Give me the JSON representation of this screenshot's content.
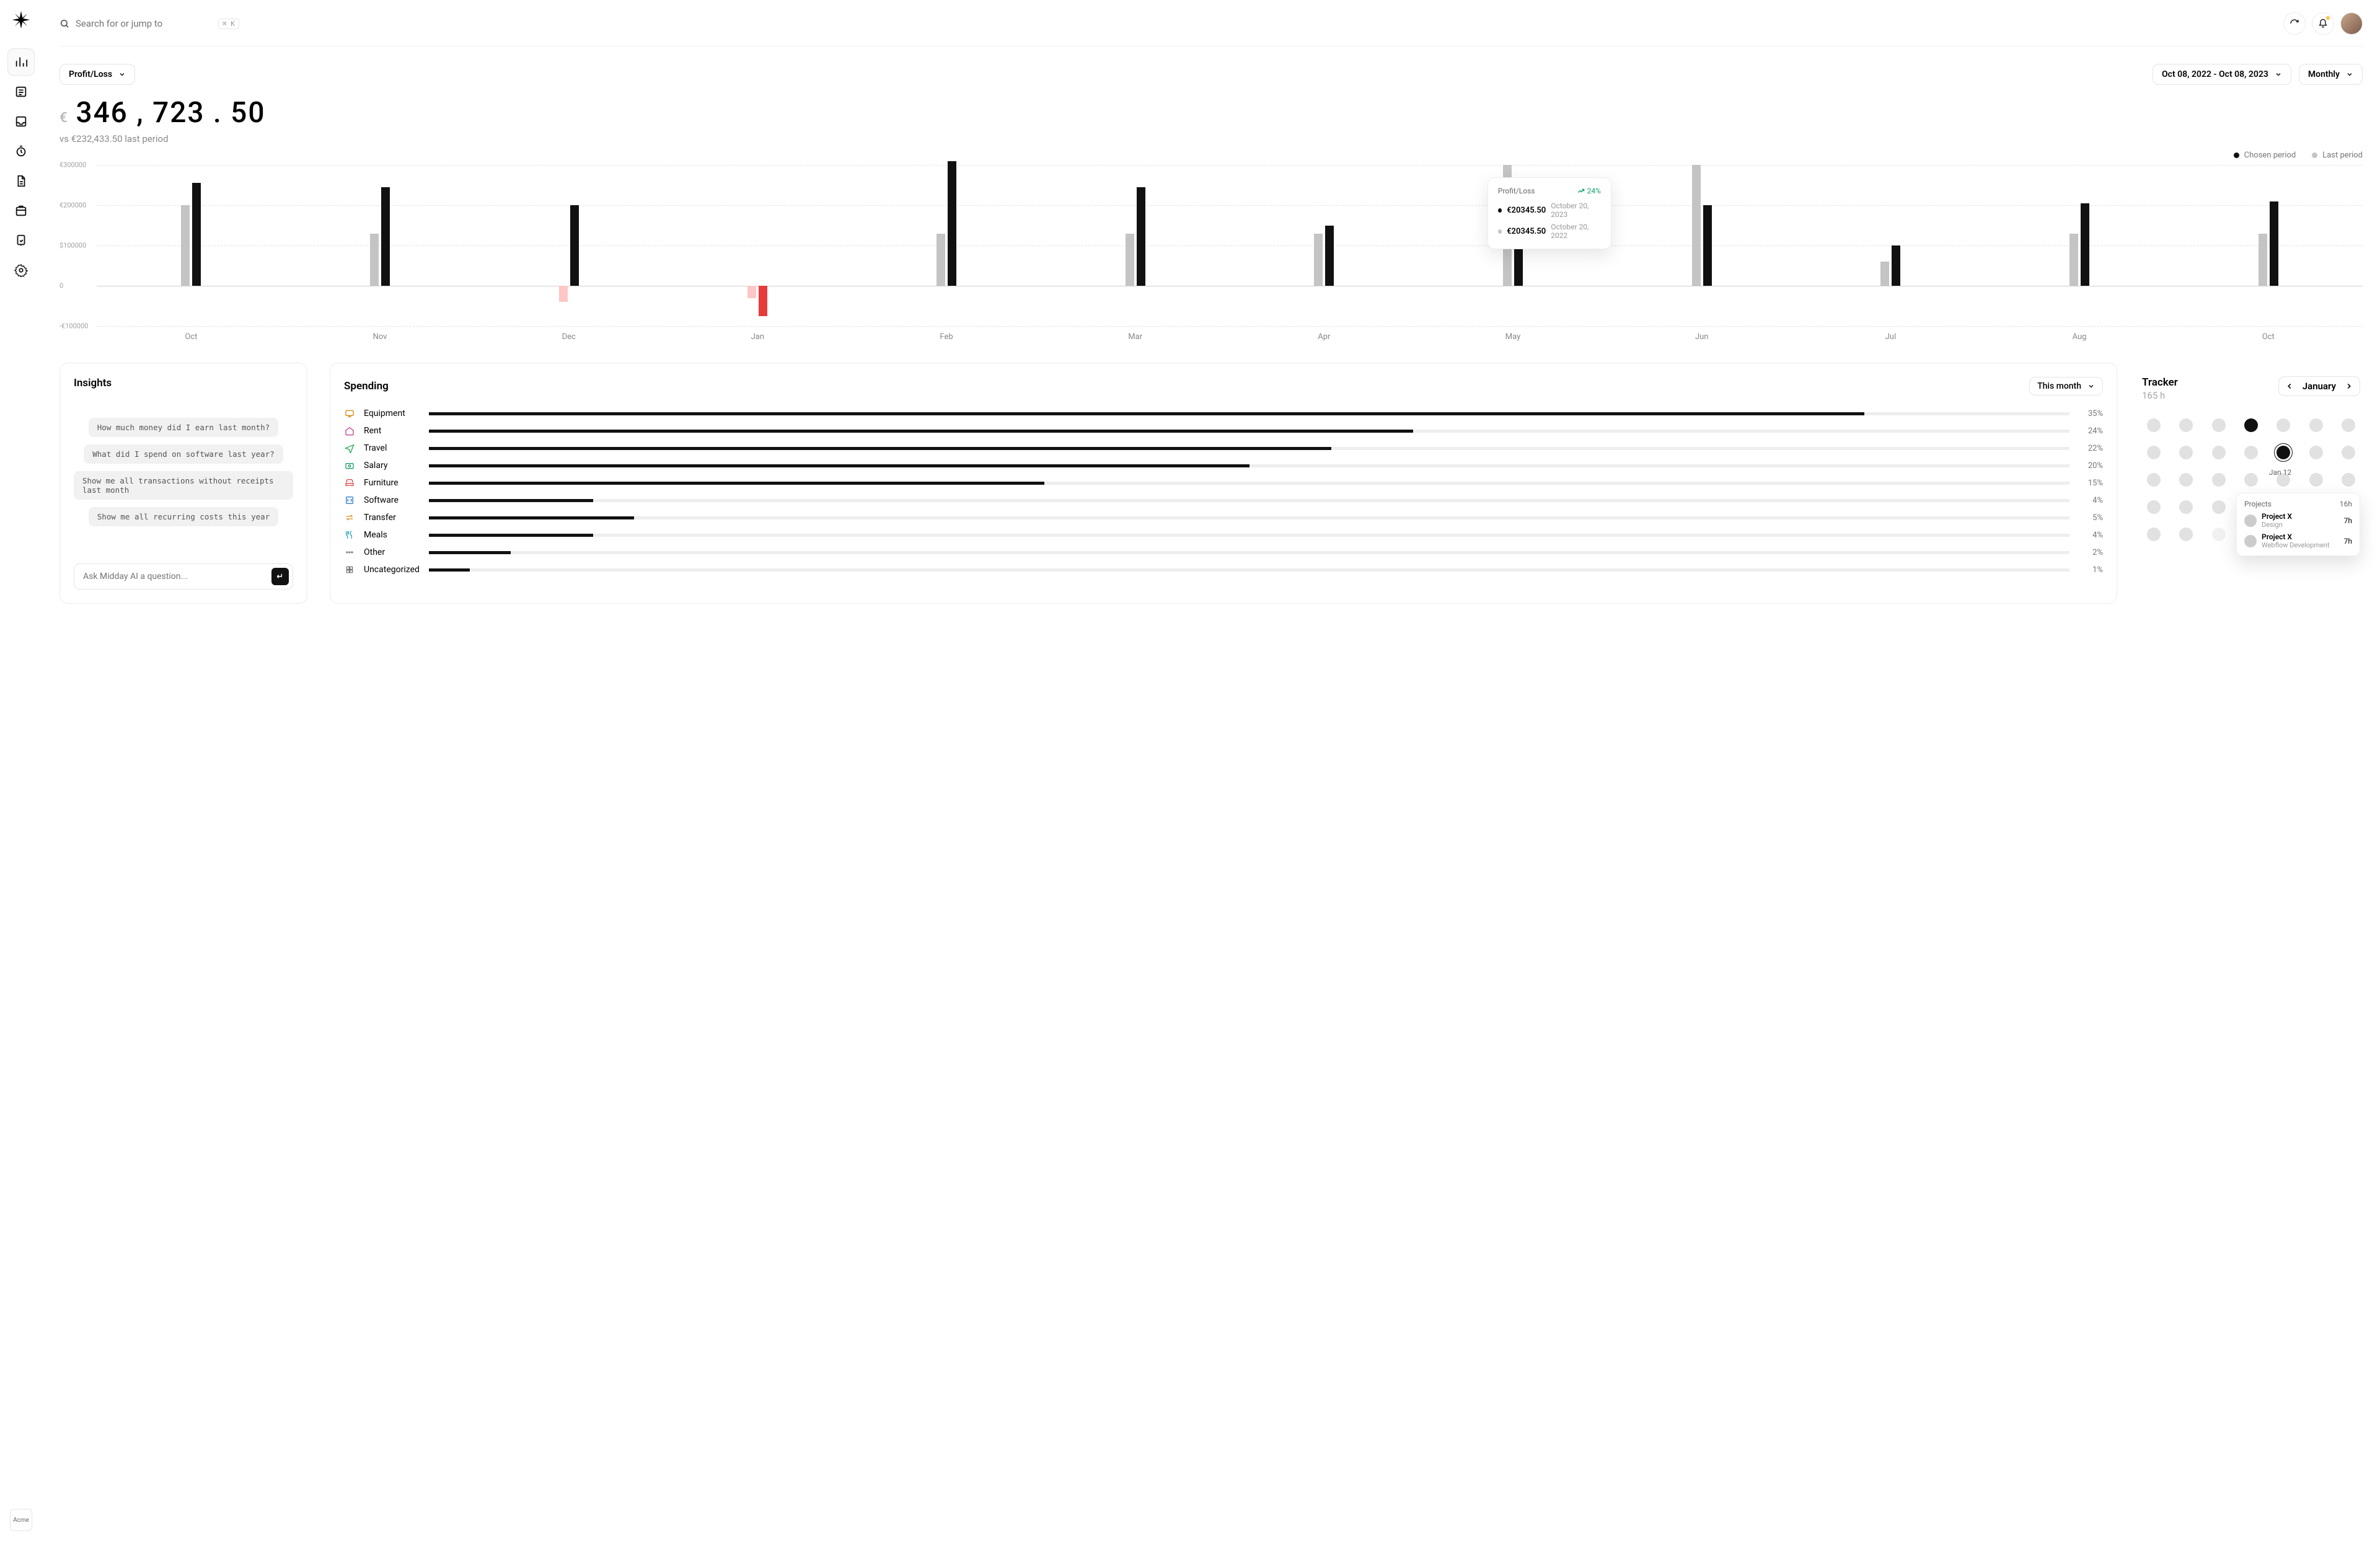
{
  "search": {
    "placeholder": "Search for or jump to",
    "shortcut": "⌘ K"
  },
  "header_actions": {
    "refresh": "refresh",
    "notifications": "notifications"
  },
  "team": {
    "label": "Acme"
  },
  "sidebar": {
    "items": [
      {
        "name": "overview",
        "active": true
      },
      {
        "name": "transactions",
        "active": false
      },
      {
        "name": "inbox",
        "active": false
      },
      {
        "name": "tracker",
        "active": false
      },
      {
        "name": "invoices",
        "active": false
      },
      {
        "name": "vault",
        "active": false
      },
      {
        "name": "apps",
        "active": false
      },
      {
        "name": "settings",
        "active": false
      }
    ]
  },
  "metric_selector": {
    "label": "Profit/Loss"
  },
  "date_range": {
    "label": "Oct 08, 2022 - Oct 08, 2023"
  },
  "granularity": {
    "label": "Monthly"
  },
  "amount": {
    "currency": "€",
    "value": "346 , 723 . 50",
    "compare_prefix": "vs ",
    "compare_value": "€232,433.50 last period"
  },
  "legend": {
    "chosen": "Chosen period",
    "last": "Last period"
  },
  "tooltip": {
    "title": "Profit/Loss",
    "change": "24%",
    "rows": [
      {
        "value": "€20345.50",
        "date": "October 20, 2023",
        "color": "#111"
      },
      {
        "value": "€20345.50",
        "date": "October 20, 2022",
        "color": "#c4c4c4"
      }
    ]
  },
  "chart_data": {
    "type": "bar",
    "title": "Profit/Loss",
    "ylabel": "",
    "xlabel": "",
    "ylim": [
      -100000,
      300000
    ],
    "currency_tick_prefix_pos": "€",
    "currency_tick_prefix_first": "$",
    "categories": [
      "Oct",
      "Nov",
      "Dec",
      "Jan",
      "Feb",
      "Mar",
      "Apr",
      "May",
      "Jun",
      "Jul",
      "Aug",
      "Oct"
    ],
    "series": [
      {
        "name": "Last period",
        "values": [
          200000,
          130000,
          -40000,
          -30000,
          130000,
          130000,
          130000,
          300000,
          300000,
          60000,
          130000,
          130000
        ]
      },
      {
        "name": "Chosen period",
        "values": [
          255000,
          245000,
          200000,
          -75000,
          310000,
          245000,
          150000,
          200000,
          200000,
          100000,
          205000,
          210000
        ]
      }
    ],
    "y_ticks": [
      "€300000",
      "€200000",
      "$100000",
      "0",
      "-€100000"
    ]
  },
  "insights": {
    "title": "Insights",
    "suggestions": [
      "How much money did I earn last month?",
      "What did I spend on software last year?",
      "Show me all transactions without receipts last month",
      "Show me all recurring costs this year"
    ],
    "ask_placeholder": "Ask Midday AI a question..."
  },
  "spending": {
    "title": "Spending",
    "period_label": "This month",
    "rows": [
      {
        "icon": "equipment",
        "iconColor": "#d68b10",
        "label": "Equipment",
        "pct": 35
      },
      {
        "icon": "rent",
        "iconColor": "#c4439a",
        "label": "Rent",
        "pct": 24
      },
      {
        "icon": "travel",
        "iconColor": "#2aa85a",
        "label": "Travel",
        "pct": 22
      },
      {
        "icon": "salary",
        "iconColor": "#1f9d63",
        "label": "Salary",
        "pct": 20
      },
      {
        "icon": "furniture",
        "iconColor": "#df4a4a",
        "label": "Furniture",
        "pct": 15
      },
      {
        "icon": "software",
        "iconColor": "#2f7fd1",
        "label": "Software",
        "pct": 4
      },
      {
        "icon": "transfer",
        "iconColor": "#e38a1f",
        "label": "Transfer",
        "pct": 5
      },
      {
        "icon": "meals",
        "iconColor": "#39acbb",
        "label": "Meals",
        "pct": 4
      },
      {
        "icon": "other",
        "iconColor": "#7b7b7b",
        "label": "Other",
        "pct": 2
      },
      {
        "icon": "uncategorized",
        "iconColor": "#7b7b7b",
        "label": "Uncategorized",
        "pct": 1
      }
    ]
  },
  "tracker": {
    "title": "Tracker",
    "hours": "165 h",
    "month_label": "January",
    "selected_label": "Jan 12",
    "popover": {
      "title": "Projects",
      "total": "16h",
      "items": [
        {
          "name": "Project X",
          "sub": "Design",
          "hours": "7h"
        },
        {
          "name": "Project X",
          "sub": "Webflow Development",
          "hours": "7h"
        }
      ]
    }
  }
}
